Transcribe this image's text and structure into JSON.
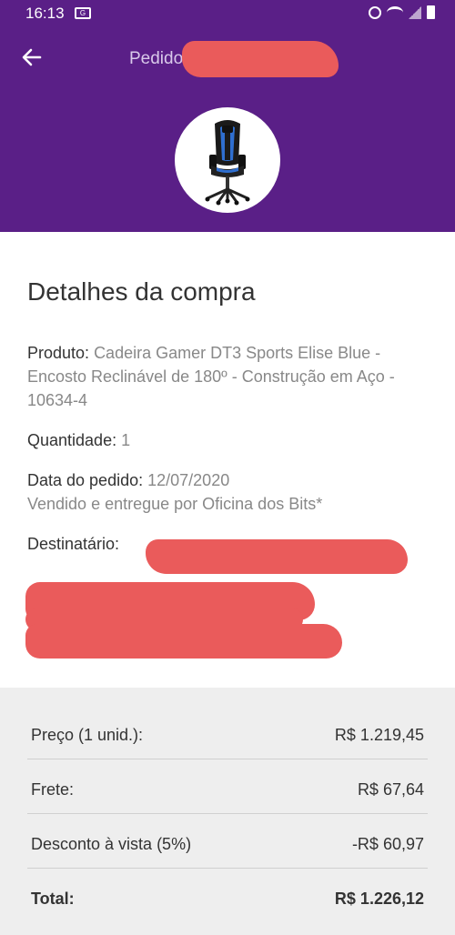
{
  "status_bar": {
    "time": "16:13"
  },
  "header": {
    "title": "Pedido"
  },
  "details": {
    "section_title": "Detalhes da compra",
    "product_label": "Produto:",
    "product_value": "Cadeira Gamer DT3 Sports Elise Blue - Encosto Reclinável de 180º - Construção em Aço - 10634-4",
    "quantity_label": "Quantidade:",
    "quantity_value": "1",
    "order_date_label": "Data do pedido:",
    "order_date_value": "12/07/2020",
    "seller_text": "Vendido e entregue por Oficina dos Bits*",
    "recipient_label": "Destinatário:"
  },
  "summary": {
    "rows": [
      {
        "label": "Preço (1 unid.):",
        "value": "R$  1.219,45"
      },
      {
        "label": "Frete:",
        "value": "R$  67,64"
      },
      {
        "label": "Desconto à vista (5%)",
        "value": "-R$  60,97"
      },
      {
        "label": "Total:",
        "value": "R$ 1.226,12"
      }
    ]
  },
  "colors": {
    "header_bg": "#5a1f87",
    "redaction": "#ea5b5b",
    "summary_bg": "#eeeeee"
  },
  "icons": {
    "back": "arrow-left-icon",
    "product": "gaming-chair-icon"
  }
}
